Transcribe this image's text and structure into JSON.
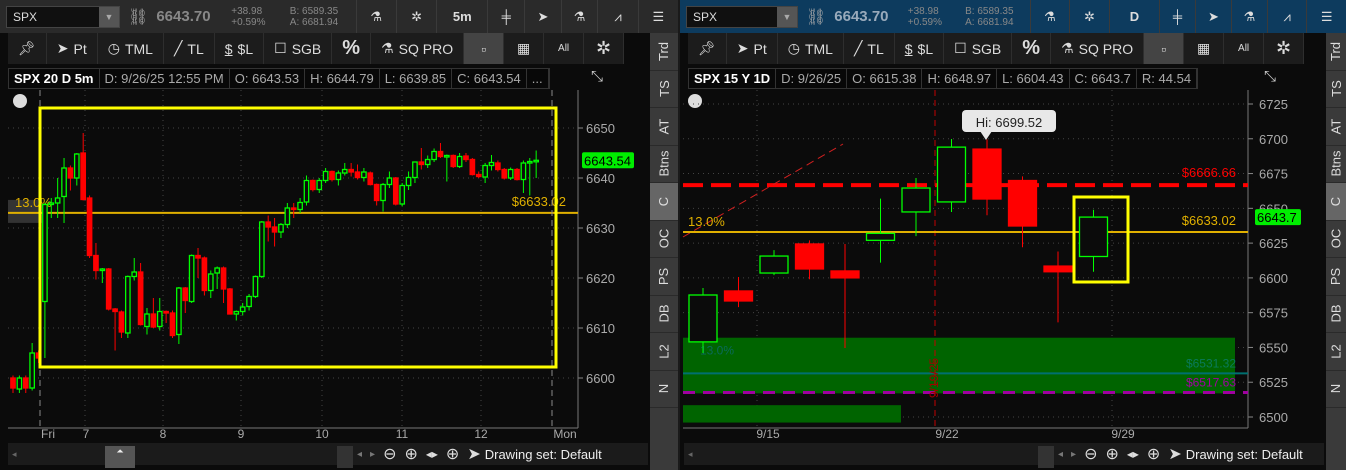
{
  "colors": {
    "up": "#00ff00",
    "down": "#ff0000",
    "yellow": "#ffff00",
    "gold": "#e0b000",
    "zone": "#006400",
    "purple": "#a000a0",
    "teal": "#007070"
  },
  "side_tabs": [
    "Trd",
    "TS",
    "AT",
    "Btns",
    "C",
    "OC",
    "PS",
    "DB",
    "L2",
    "N"
  ],
  "active_tab": "C",
  "toolbar": {
    "pt": "Pt",
    "tml": "TML",
    "tl": "TL",
    "sl": "$L",
    "sgb": "SGB",
    "pct": "%",
    "sqpro": "SQ PRO",
    "all": "All"
  },
  "drawing_set": "Drawing set: Default",
  "panels": [
    {
      "symbol": "SPX",
      "last": "6643.70",
      "change": "+38.98",
      "change_pct": "+0.59%",
      "bid": "B: 6589.35",
      "ask": "A: 6681.94",
      "timeframe": "5m",
      "info": {
        "title": "SPX 20 D 5m",
        "date": "D: 9/26/25 12:55 PM",
        "open": "O: 6643.53",
        "high": "H: 6644.79",
        "low": "L: 6639.85",
        "close": "C: 6643.54",
        "more": "..."
      },
      "y_ticks": [
        "6650",
        "6640",
        "6630",
        "6620",
        "6610",
        "6600"
      ],
      "y_tick_values": [
        6650,
        6640,
        6630,
        6620,
        6610,
        6600
      ],
      "x_labels": [
        "Fri",
        "7",
        "8",
        "9",
        "10",
        "11",
        "12",
        "Mon"
      ],
      "price_badge": "6643.54",
      "line_label": "$6633.02",
      "line_value": 6633.02,
      "pct_label": "13.0%",
      "candles": [
        [
          6600,
          6600.5,
          6597,
          6598
        ],
        [
          6597.8,
          6600.5,
          6597,
          6600
        ],
        [
          6600,
          6600.5,
          6597,
          6598
        ],
        [
          6598,
          6607,
          6597.5,
          6605
        ],
        [
          6605,
          6605.5,
          6603,
          6604
        ],
        [
          6615.3,
          6635,
          6604,
          6634.7
        ],
        [
          6635,
          6636,
          6632,
          6635
        ],
        [
          6635,
          6640,
          6632,
          6636
        ],
        [
          6636.3,
          6644,
          6631,
          6642
        ],
        [
          6642,
          6642.5,
          6637.5,
          6640
        ],
        [
          6640,
          6645,
          6638.5,
          6644.8
        ],
        [
          6645,
          6649,
          6635.5,
          6635.7
        ],
        [
          6636,
          6636.5,
          6624,
          6624.5
        ],
        [
          6624.5,
          6627,
          6619.7,
          6621.5
        ],
        [
          6621.8,
          6622,
          6619,
          6621.8
        ],
        [
          6621.8,
          6622,
          6613.5,
          6613.8
        ],
        [
          6613.8,
          6614,
          6605.5,
          6613.3
        ],
        [
          6613.2,
          6613.5,
          6608,
          6609.2
        ],
        [
          6609,
          6620.5,
          6608,
          6620.3
        ],
        [
          6620.3,
          6624,
          6619.5,
          6621.2
        ],
        [
          6621.2,
          6623,
          6610.5,
          6610.7
        ],
        [
          6610.3,
          6614,
          6608.7,
          6612.8
        ],
        [
          6612.8,
          6616,
          6610,
          6610.2
        ],
        [
          6610.3,
          6616,
          6609.5,
          6613.3
        ],
        [
          6613.3,
          6613.5,
          6611,
          6613
        ],
        [
          6613,
          6613.5,
          6608,
          6608.5
        ],
        [
          6608.7,
          6618.2,
          6606.8,
          6618
        ],
        [
          6618,
          6618.2,
          6613,
          6615.5
        ],
        [
          6615.3,
          6624.7,
          6615,
          6624.5
        ],
        [
          6624.5,
          6626,
          6620,
          6624
        ],
        [
          6624,
          6624.3,
          6616.5,
          6617.5
        ],
        [
          6617.5,
          6621.5,
          6616,
          6620.8
        ],
        [
          6621,
          6622.3,
          6617.8,
          6622
        ],
        [
          6622,
          6622.3,
          6615,
          6617.8
        ],
        [
          6617.8,
          6618,
          6612.8,
          6612.8
        ],
        [
          6612.8,
          6613.5,
          6611.5,
          6613.3
        ],
        [
          6613.3,
          6615,
          6612.5,
          6614.2
        ],
        [
          6614.3,
          6616.8,
          6613.5,
          6616.3
        ],
        [
          6616.3,
          6620.5,
          6616,
          6620.3
        ],
        [
          6620.3,
          6631.4,
          6620,
          6631.2
        ],
        [
          6631.2,
          6632.5,
          6627.3,
          6630.2
        ],
        [
          6630.2,
          6632,
          6626.3,
          6629.2
        ],
        [
          6629.2,
          6631,
          6628,
          6630.7
        ],
        [
          6630.7,
          6635,
          6630,
          6634
        ],
        [
          6634,
          6635,
          6632,
          6633.7
        ],
        [
          6633.7,
          6636,
          6633,
          6635.1
        ],
        [
          6635.2,
          6640.5,
          6634.5,
          6639.5
        ],
        [
          6639.5,
          6639.7,
          6637.3,
          6637.7
        ],
        [
          6637.7,
          6640,
          6637,
          6639.5
        ],
        [
          6639.5,
          6642,
          6639,
          6641.3
        ],
        [
          6641.3,
          6641.5,
          6639.3,
          6639.7
        ],
        [
          6639.7,
          6641.5,
          6638.5,
          6641
        ],
        [
          6641,
          6643,
          6640.5,
          6641.7
        ],
        [
          6641.7,
          6643,
          6640.3,
          6641.2
        ],
        [
          6641.2,
          6642.7,
          6639.7,
          6640.1
        ],
        [
          6640.1,
          6642,
          6639.3,
          6641.2
        ],
        [
          6641,
          6641.3,
          6638.5,
          6638.7
        ],
        [
          6638.7,
          6638.9,
          6634.5,
          6635.5
        ],
        [
          6635.5,
          6639,
          6633.3,
          6638.7
        ],
        [
          6638.7,
          6641.3,
          6638,
          6640
        ],
        [
          6640,
          6640.2,
          6634.5,
          6634.8
        ],
        [
          6634.8,
          6639,
          6634.3,
          6638.5
        ],
        [
          6638.5,
          6641.3,
          6637.6,
          6640.1
        ],
        [
          6640.1,
          6643.3,
          6639,
          6643.2
        ],
        [
          6643.2,
          6646,
          6641.7,
          6642.7
        ],
        [
          6642.7,
          6644.5,
          6642,
          6643.7
        ],
        [
          6643.7,
          6645.9,
          6643.2,
          6645.3
        ],
        [
          6645.3,
          6647,
          6644,
          6644.3
        ],
        [
          6644.5,
          6644.7,
          6639.3,
          6644.5
        ],
        [
          6644.5,
          6644.7,
          6642,
          6642.3
        ],
        [
          6642.3,
          6645,
          6642,
          6644.3
        ],
        [
          6644.4,
          6645,
          6643.2,
          6643.7
        ],
        [
          6643.7,
          6644,
          6640.5,
          6640.7
        ],
        [
          6640.7,
          6641.3,
          6640,
          6640.3
        ],
        [
          6640.2,
          6643,
          6639,
          6642.5
        ],
        [
          6642.5,
          6644.6,
          6641.5,
          6643.1
        ],
        [
          6643,
          6643.5,
          6641.3,
          6641.7
        ],
        [
          6641.7,
          6642,
          6639.7,
          6640
        ],
        [
          6640,
          6642.1,
          6639.6,
          6641.7
        ],
        [
          6641.7,
          6642,
          6639.5,
          6639.7
        ],
        [
          6639.7,
          6643.5,
          6637,
          6643
        ],
        [
          6643,
          6644,
          6636.5,
          6643.3
        ],
        [
          6643.53,
          6645.5,
          6640,
          6643.54
        ]
      ]
    },
    {
      "symbol": "SPX",
      "last": "6643.70",
      "change": "+38.98",
      "change_pct": "+0.59%",
      "bid": "B: 6589.35",
      "ask": "A: 6681.94",
      "timeframe": "D",
      "info": {
        "title": "SPX 15 Y 1D",
        "date": "D: 9/26/25",
        "open": "O: 6615.38",
        "high": "H: 6648.97",
        "low": "L: 6604.43",
        "close": "C: 6643.7",
        "range": "R: 44.54"
      },
      "y_ticks": [
        "6725",
        "6700",
        "6675",
        "6650",
        "6625",
        "6600",
        "6575",
        "6550",
        "6525",
        "6500"
      ],
      "y_tick_values": [
        6725,
        6700,
        6675,
        6650,
        6625,
        6600,
        6575,
        6550,
        6525,
        6500
      ],
      "x_labels": [
        "9/15",
        "9/22",
        "9/29"
      ],
      "price_badge": "6643.7",
      "line_label": "$6633.02",
      "line_value": 6633.02,
      "pct_label": "13.0%",
      "resistance_label": "$6666.66",
      "resistance_value": 6666.66,
      "support_label": "$6517.63",
      "support_value": 6517.63,
      "teal_label": "$6531.32",
      "teal_value": 6531.32,
      "vline_label": "9/19/25",
      "hi_tooltip": "Hi: 6699.52",
      "candles": [
        [
          6554,
          6592.7,
          6546,
          6587.7
        ],
        [
          6590.6,
          6600.6,
          6579,
          6583.4
        ],
        [
          6603.5,
          6620,
          6602,
          6615.7
        ],
        [
          6624.4,
          6627,
          6599,
          6606.4
        ],
        [
          6605,
          6624.4,
          6549.6,
          6600
        ],
        [
          6627,
          6657,
          6611,
          6632
        ],
        [
          6647.4,
          6671.8,
          6630,
          6664.6
        ],
        [
          6654.6,
          6699.8,
          6647.4,
          6694
        ],
        [
          6692.6,
          6699.52,
          6645,
          6656.7
        ],
        [
          6670,
          6673,
          6622,
          6637.3
        ],
        [
          6608.5,
          6619,
          6568,
          6604.4
        ],
        [
          6615.38,
          6648.97,
          6604.43,
          6643.7
        ]
      ]
    }
  ]
}
